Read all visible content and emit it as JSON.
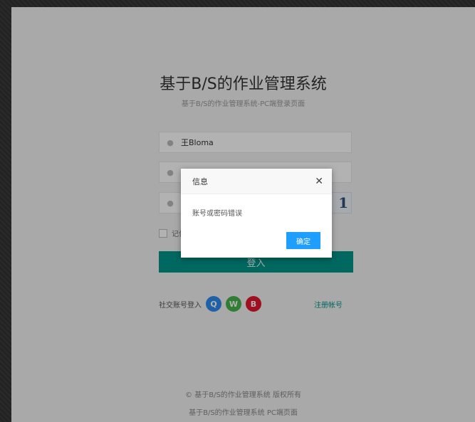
{
  "page": {
    "title": "基于B/S的作业管理系统",
    "subtitle": "基于B/S的作业管理系统-PC端登录页面"
  },
  "form": {
    "username_value": "王Bloma",
    "remember_label": "记住密码",
    "login_label": "登入"
  },
  "captcha": {
    "text": "1"
  },
  "social": {
    "label": "社交账号登入",
    "icons": [
      "qq-icon",
      "wechat-icon",
      "weibo-icon"
    ]
  },
  "register_label": "注册帐号",
  "footer": {
    "line1": "© 基于B/S的作业管理系统 版权所有",
    "line2": "基于B/S的作业管理系统 PC端页面"
  },
  "dialog": {
    "title": "信息",
    "close_glyph": "✕",
    "message": "账号或密码错误",
    "ok_label": "确定"
  },
  "colors": {
    "primary": "#009688",
    "dialog_button": "#1e9fff",
    "background": "#f2f2f2"
  }
}
